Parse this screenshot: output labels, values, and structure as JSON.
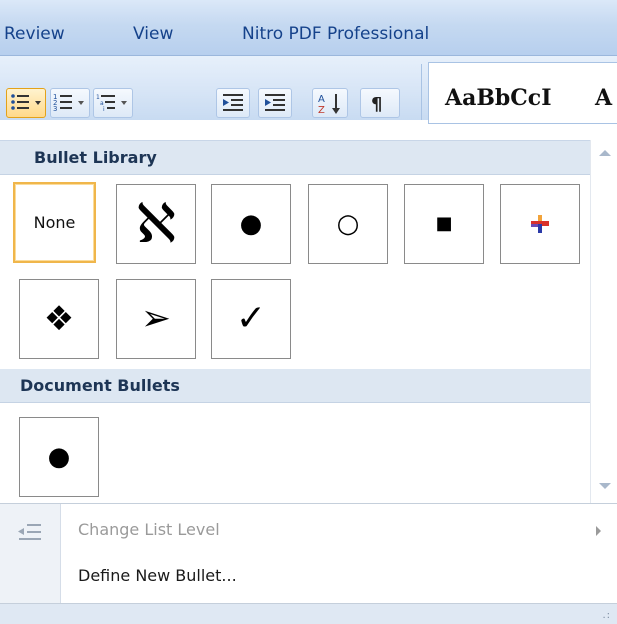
{
  "ribbon": {
    "tabs": [
      {
        "label": "Review"
      },
      {
        "label": "View"
      },
      {
        "label": "Nitro PDF Professional"
      }
    ],
    "style_samples": [
      "AaBbCcI",
      "A"
    ],
    "buttons": [
      {
        "name": "bullets-button",
        "icon": "bulleted-list-icon",
        "state": "active"
      },
      {
        "name": "numbering-button",
        "icon": "numbered-list-icon"
      },
      {
        "name": "multilevel-list-button",
        "icon": "multilevel-list-icon"
      },
      {
        "name": "decrease-indent-button",
        "icon": "decrease-indent-icon"
      },
      {
        "name": "increase-indent-button",
        "icon": "increase-indent-icon"
      },
      {
        "name": "sort-button",
        "icon": "sort-az-icon"
      },
      {
        "name": "show-formatting-button",
        "icon": "pilcrow-icon"
      }
    ]
  },
  "bullet_library": {
    "header": "Bullet Library",
    "items": [
      {
        "label": "None",
        "selected": true
      },
      {
        "glyph": "ℵ",
        "icon": "alef-bullet-icon"
      },
      {
        "glyph": "●",
        "icon": "filled-circle-bullet-icon"
      },
      {
        "glyph": "○",
        "icon": "hollow-circle-bullet-icon"
      },
      {
        "glyph": "■",
        "icon": "square-bullet-icon"
      },
      {
        "glyph": "+",
        "icon": "colored-cross-bullet-icon"
      },
      {
        "glyph": "❖",
        "icon": "diamond-cluster-bullet-icon"
      },
      {
        "glyph": "➢",
        "icon": "arrowhead-bullet-icon"
      },
      {
        "glyph": "✓",
        "icon": "checkmark-bullet-icon"
      }
    ]
  },
  "document_bullets": {
    "header": "Document Bullets",
    "items": [
      {
        "glyph": "●",
        "icon": "filled-circle-bullet-icon"
      }
    ]
  },
  "menu": {
    "change_list_level": {
      "label": "Change List Level",
      "disabled": true
    },
    "define_new_bullet": {
      "label": "Define New Bullet..."
    }
  },
  "colors": {
    "selected_border": "#f0b64b",
    "header_bg": "#dde7f2",
    "tab_text": "#15428b"
  }
}
